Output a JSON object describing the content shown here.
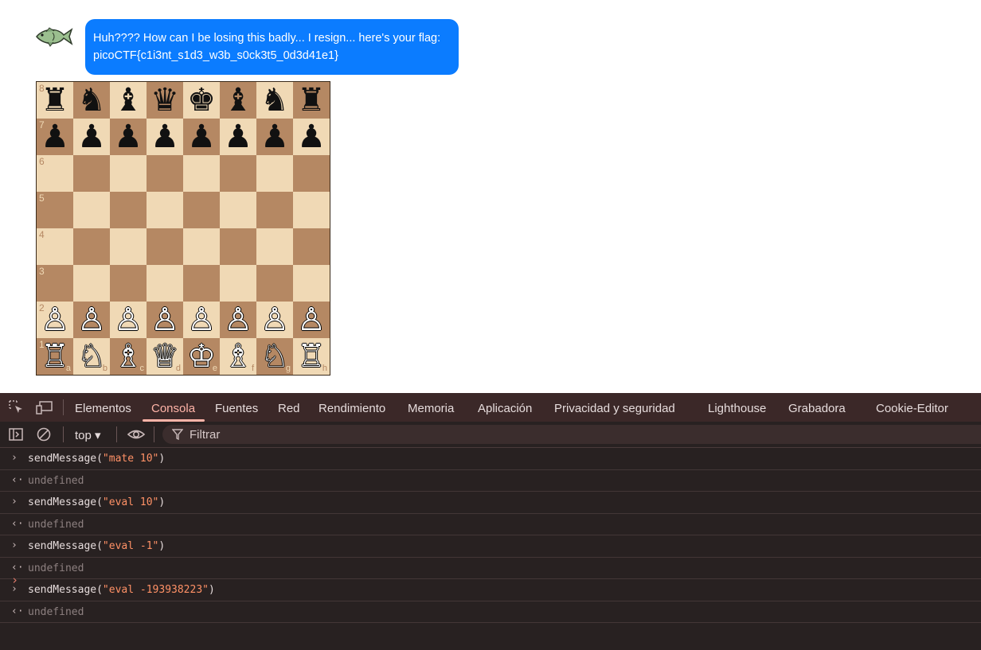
{
  "chat": {
    "avatar_icon": "fish-icon",
    "message_line1": "Huh???? How can I be losing this badly... I resign... here's your flag:",
    "message_line2": "picoCTF{c1i3nt_s1d3_w3b_s0ck3t5_0d3d41e1}",
    "bubble_color": "#0b7cff"
  },
  "board": {
    "light_color": "#f0d9b5",
    "dark_color": "#b58863",
    "rank_labels": [
      "8",
      "7",
      "6",
      "5",
      "4",
      "3",
      "2",
      "1"
    ],
    "file_labels": [
      "a",
      "b",
      "c",
      "d",
      "e",
      "f",
      "g",
      "h"
    ],
    "ranks": [
      [
        "♜",
        "♞",
        "♝",
        "♛",
        "♚",
        "♝",
        "♞",
        "♜"
      ],
      [
        "♟",
        "♟",
        "♟",
        "♟",
        "♟",
        "♟",
        "♟",
        "♟"
      ],
      [
        "",
        "",
        "",
        "",
        "",
        "",
        "",
        ""
      ],
      [
        "",
        "",
        "",
        "",
        "",
        "",
        "",
        ""
      ],
      [
        "",
        "",
        "",
        "",
        "",
        "",
        "",
        ""
      ],
      [
        "",
        "",
        "",
        "",
        "",
        "",
        "",
        ""
      ],
      [
        "♙",
        "♙",
        "♙",
        "♙",
        "♙",
        "♙",
        "♙",
        "♙"
      ],
      [
        "♖",
        "♘",
        "♗",
        "♕",
        "♔",
        "♗",
        "♘",
        "♖"
      ]
    ]
  },
  "devtools": {
    "tabs": [
      "Elementos",
      "Consola",
      "Fuentes",
      "Red",
      "Rendimiento",
      "Memoria",
      "Aplicación",
      "Privacidad y seguridad",
      "Lighthouse",
      "Grabadora",
      "Cookie-Editor"
    ],
    "active_tab": "Consola",
    "context": "top ▾",
    "filter_placeholder": "Filtrar",
    "console": [
      {
        "kind": "in",
        "fn": "sendMessage(",
        "arg": "\"mate 10\"",
        "close": ")"
      },
      {
        "kind": "out",
        "text": "undefined"
      },
      {
        "kind": "in",
        "fn": "sendMessage(",
        "arg": "\"eval 10\"",
        "close": ")"
      },
      {
        "kind": "out",
        "text": "undefined"
      },
      {
        "kind": "in",
        "fn": "sendMessage(",
        "arg": "\"eval -1\"",
        "close": ")"
      },
      {
        "kind": "out",
        "text": "undefined"
      },
      {
        "kind": "in",
        "fn": "sendMessage(",
        "arg": "\"eval -193938223\"",
        "close": ")"
      },
      {
        "kind": "out",
        "text": "undefined"
      }
    ],
    "prompt_symbol": "›"
  }
}
